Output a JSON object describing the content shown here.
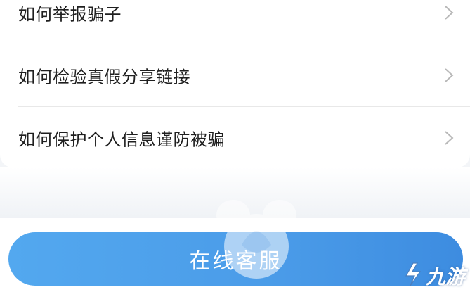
{
  "faq": {
    "items": [
      {
        "label": "如何举报骗子",
        "icon": "chevron-right-icon"
      },
      {
        "label": "如何检验真假分享链接",
        "icon": "chevron-right-icon"
      },
      {
        "label": "如何保护个人信息谨防被骗",
        "icon": "chevron-right-icon"
      }
    ]
  },
  "bottom": {
    "service_button_label": "在线客服"
  },
  "watermark": {
    "brand_text": "九游",
    "logo_icon": "jiuyou-logo-icon"
  },
  "colors": {
    "button_gradient_start": "#53a8ef",
    "button_gradient_end": "#3d8ce0",
    "text": "#1f1f1f",
    "chevron": "#b8b8b8",
    "background": "#f3f5f8"
  }
}
